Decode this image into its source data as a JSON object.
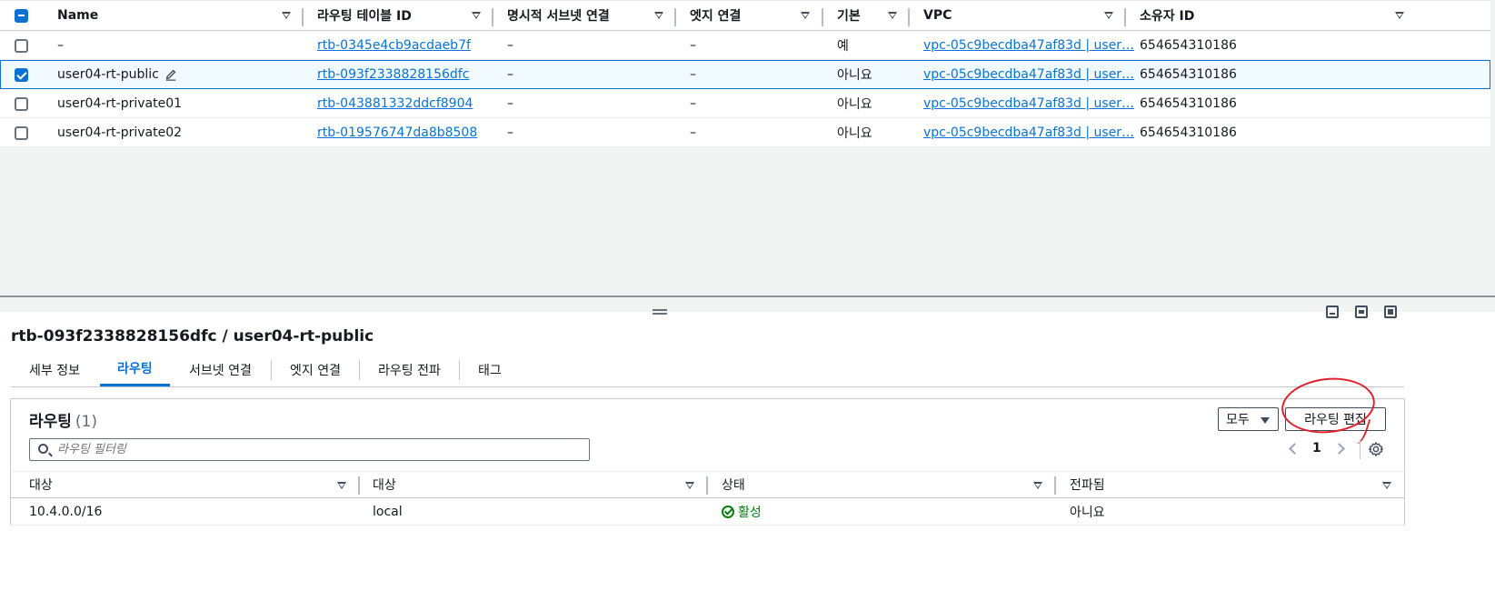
{
  "top_table": {
    "columns": [
      "Name",
      "라우팅 테이블 ID",
      "명시적 서브넷 연결",
      "엣지 연결",
      "기본",
      "VPC",
      "소유자 ID"
    ],
    "rows": [
      {
        "name": "–",
        "rtb_id": "rtb-0345e4cb9acdaeb7f",
        "subnet": "–",
        "edge": "–",
        "main": "예",
        "vpc": "vpc-05c9becdba47af83d | user…",
        "owner": "654654310186",
        "selected": false
      },
      {
        "name": "user04-rt-public",
        "rtb_id": "rtb-093f2338828156dfc",
        "subnet": "–",
        "edge": "–",
        "main": "아니요",
        "vpc": "vpc-05c9becdba47af83d | user…",
        "owner": "654654310186",
        "selected": true
      },
      {
        "name": "user04-rt-private01",
        "rtb_id": "rtb-043881332ddcf8904",
        "subnet": "–",
        "edge": "–",
        "main": "아니요",
        "vpc": "vpc-05c9becdba47af83d | user…",
        "owner": "654654310186",
        "selected": false
      },
      {
        "name": "user04-rt-private02",
        "rtb_id": "rtb-019576747da8b8508",
        "subnet": "–",
        "edge": "–",
        "main": "아니요",
        "vpc": "vpc-05c9becdba47af83d | user…",
        "owner": "654654310186",
        "selected": false
      }
    ]
  },
  "detail": {
    "title": "rtb-093f2338828156dfc / user04-rt-public",
    "tabs": [
      "세부 정보",
      "라우팅",
      "서브넷 연결",
      "엣지 연결",
      "라우팅 전파",
      "태그"
    ],
    "active_tab": "라우팅"
  },
  "routes": {
    "title": "라우팅",
    "count": "(1)",
    "filter_button": "모두",
    "edit_button": "라우팅 편집",
    "filter_placeholder": "라우팅 필터링",
    "page": "1",
    "columns": [
      "대상",
      "대상",
      "상태",
      "전파됨"
    ],
    "rows": [
      {
        "destination": "10.4.0.0/16",
        "target": "local",
        "status": "활성",
        "propagated": "아니요"
      }
    ]
  },
  "colors": {
    "accent": "#0972d3",
    "success": "#037f0c",
    "annotation": "#e0222c"
  },
  "icons": [
    "checkbox",
    "sort-caret",
    "pencil-icon",
    "drag-handle",
    "search-icon",
    "chevron-left-icon",
    "chevron-right-icon",
    "gear-icon",
    "status-success-icon"
  ]
}
